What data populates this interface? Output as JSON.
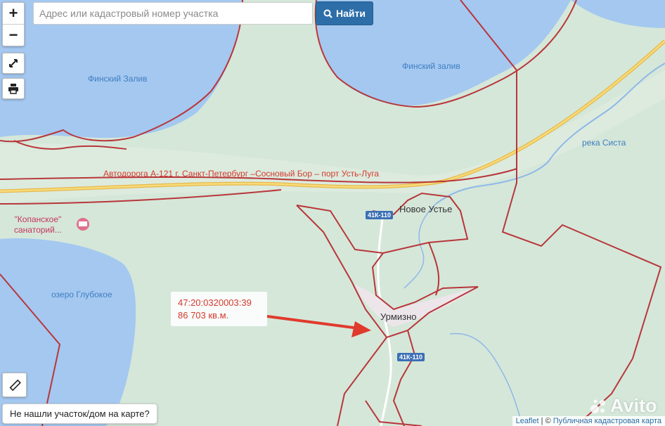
{
  "search": {
    "placeholder": "Адрес или кадастровый номер участка",
    "button_label": "Найти"
  },
  "zoom": {
    "in": "+",
    "out": "−"
  },
  "map_labels": {
    "gulf_left": "Финский Залив",
    "gulf_right": "Финский залив",
    "river": "река Систа",
    "road": "Автодорога А-121 г. Санкт-Петербург –Сосновый Бор – порт Усть-Луга",
    "sanatorium_line1": "\"Копанское\"",
    "sanatorium_line2": "санаторий...",
    "lake": "озеро Глубокое",
    "town_novoe": "Новое Устье",
    "town_urmizno": "Урмизно",
    "shield_1": "41К-110",
    "shield_2": "41К-110"
  },
  "parcel_popup": {
    "number": "47:20:0320003:39",
    "area": "86 703 кв.м."
  },
  "not_found_button": "Не нашли участок/дом на карте?",
  "attribution": {
    "leaflet": "Leaflet",
    "sep": " | © ",
    "source": "Публичная кадастровая карта"
  },
  "watermark": "Avito",
  "colors": {
    "water": "#a4c8f0",
    "land": "#d5e7d9",
    "parcel_border": "#b8363a",
    "arrow": "#e03a2c",
    "road": "#f0c44a",
    "button": "#2d6ea8"
  }
}
